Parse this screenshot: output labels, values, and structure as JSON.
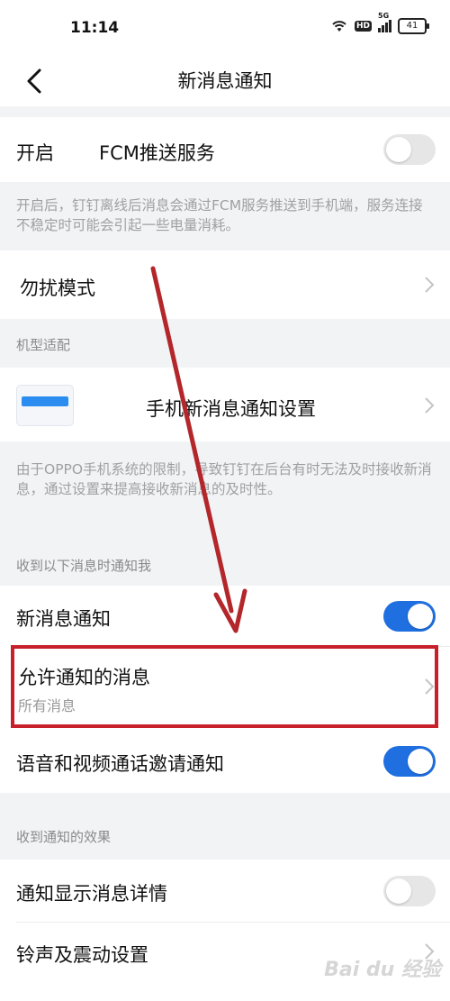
{
  "status_bar": {
    "time": "11:14",
    "hd": "HD",
    "network": "5G",
    "battery": "41"
  },
  "nav": {
    "title": "新消息通知"
  },
  "fcm": {
    "label_prefix": "开启",
    "label_suffix": "FCM推送服务",
    "enabled": false,
    "description": "开启后，钉钉离线后消息会通过FCM服务推送到手机端，服务连接不稳定时可能会引起一些电量消耗。"
  },
  "dnd": {
    "label": "勿扰模式"
  },
  "model_adapt": {
    "section_title": "机型适配",
    "setting_label": "手机新消息通知设置",
    "description": "由于OPPO手机系统的限制，导致钉钉在后台有时无法及时接收新消息，通过设置来提高接收新消息的及时性。"
  },
  "notify_when": {
    "section_title": "收到以下消息时通知我",
    "new_message": {
      "label": "新消息通知",
      "enabled": true
    },
    "allowed_messages": {
      "label": "允许通知的消息",
      "value": "所有消息"
    },
    "call_invite": {
      "label": "语音和视频通话邀请通知",
      "enabled": true
    }
  },
  "effects": {
    "section_title": "收到通知的效果",
    "show_details": {
      "label": "通知显示消息详情",
      "enabled": false
    },
    "ringtone": {
      "label": "铃声及震动设置"
    }
  },
  "watermark": "Bai du 经验",
  "colors": {
    "toggle_on": "#1f6fe0",
    "toggle_off": "#e6e6e6",
    "highlight": "#c8202a",
    "arrow": "#b3262a"
  }
}
